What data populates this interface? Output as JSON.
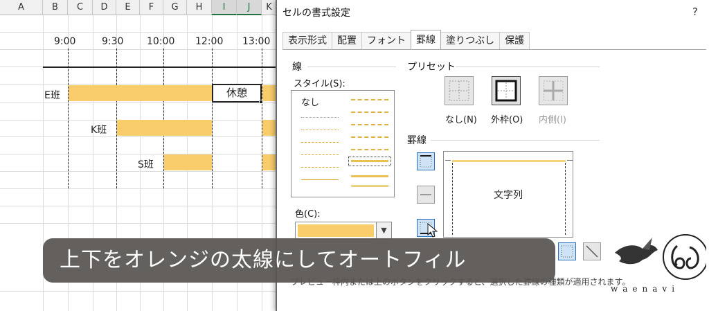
{
  "sheet": {
    "columns": [
      "A",
      "B",
      "C",
      "D",
      "E",
      "F",
      "G",
      "H",
      "I",
      "J",
      "K"
    ],
    "selected_columns": [
      "I",
      "J"
    ],
    "times": [
      "9:00",
      "9:30",
      "10:00",
      "12:00",
      "13:00"
    ],
    "groups": [
      {
        "label": "E班"
      },
      {
        "label": "K班"
      },
      {
        "label": "S班"
      }
    ],
    "rest_cell": "休憩"
  },
  "dialog": {
    "title": "セルの書式設定",
    "help": "?",
    "tabs": [
      "表示形式",
      "配置",
      "フォント",
      "罫線",
      "塗りつぶし",
      "保護"
    ],
    "active_tab": "罫線",
    "line_section": "線",
    "style_label": "スタイル(S):",
    "none_label": "なし",
    "color_label": "色(C):",
    "color_value": "#f9cd6b",
    "preset_section": "プリセット",
    "presets": [
      {
        "label": "なし(N)",
        "state": "normal"
      },
      {
        "label": "外枠(O)",
        "state": "active"
      },
      {
        "label": "内側(I)",
        "state": "disabled"
      }
    ],
    "border_section": "罫線",
    "preview_text": "文字列",
    "note": "プレビュー枠内または上のボタンをクリックすると、選択した罫線の種類が適用されます。"
  },
  "caption": "上下をオレンジの太線にしてオートフィル",
  "logo": {
    "text": "waenavi"
  },
  "colors": {
    "bar": "#f9cd6b",
    "accent": "#217346"
  }
}
